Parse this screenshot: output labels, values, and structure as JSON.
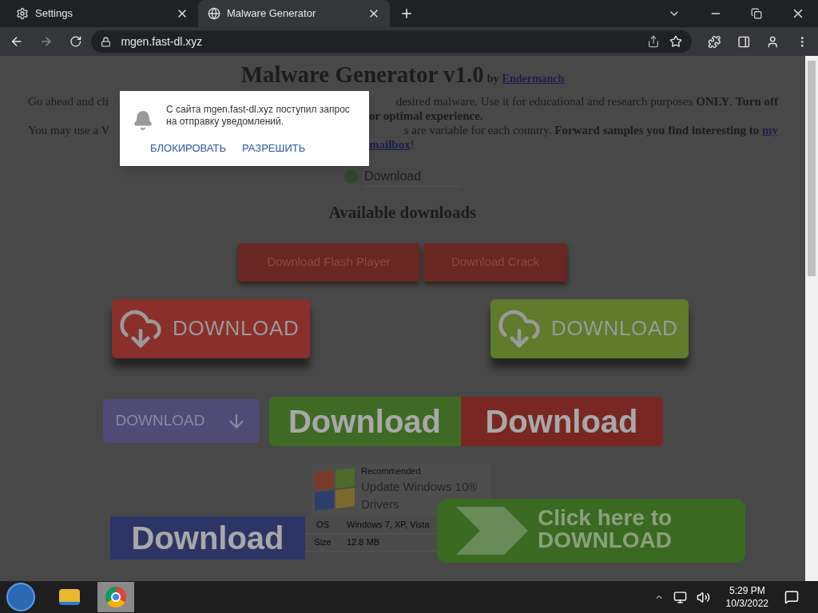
{
  "tabs": [
    {
      "label": "Settings",
      "kind": "settings",
      "selected": false
    },
    {
      "label": "Malware Generator",
      "kind": "page",
      "selected": true
    }
  ],
  "address": "mgen.fast-dl.xyz",
  "page": {
    "title": "Malware Generator v1.0",
    "byline": "by",
    "author": "Endermanch",
    "intro": [
      {
        "left": "Go ahead and cli",
        "right": "desired malware. Use it for educational and research purposes **ONLY**. **Turn off**"
      },
      {
        "right": "**or optimal experience.**"
      },
      {
        "left": "You may use a V",
        "right": "s are variable for each country. **Forward samples you find interesting to**",
        "link": "my"
      },
      {
        "link": "mailbox",
        "after": "!"
      }
    ],
    "radio": {
      "label": "Download",
      "selected": false
    },
    "heading": "Available downloads",
    "buttons": [
      "Download Flash Player",
      "Download Crack"
    ],
    "banners": [
      {
        "kind": "cloud",
        "label": "DOWNLOAD",
        "color": "#8b2f2a"
      },
      {
        "kind": "cloud",
        "label": "DOWNLOAD",
        "color": "#5f7b2b"
      }
    ],
    "banners_2": [
      {
        "kind": "arrow",
        "label": "DOWNLOAD",
        "color": "#4f4b76"
      },
      {
        "kind": "bold",
        "label": "Download",
        "color": "#3f6a25"
      },
      {
        "kind": "bold",
        "label": "Download",
        "color": "#7a2723"
      }
    ],
    "ad": {
      "tag": "Recommended",
      "title": "Update Windows 10®",
      "subtitle": "Drivers",
      "rows": [
        {
          "label": "OS",
          "value": "Windows 7, XP, Vista"
        },
        {
          "label": "Size",
          "value": "12.8 MB"
        }
      ]
    },
    "bottom_banner": {
      "kind": "bold",
      "label": "Download",
      "color": "#2d3566"
    },
    "click_banner": {
      "lines": [
        "Click here to",
        "DOWNLOAD"
      ]
    }
  },
  "notification": {
    "text": "С сайта mgen.fast-dl.xyz поступил запрос на отправку уведомлений.",
    "actions": [
      "БЛОКИРОВАТЬ",
      "РАЗРЕШИТЬ"
    ]
  },
  "taskbar": {
    "apps": [
      {
        "kind": "folder",
        "selected": false
      },
      {
        "kind": "chrome",
        "selected": true
      }
    ],
    "time": "5:29 PM",
    "date": "10/3/2022"
  }
}
